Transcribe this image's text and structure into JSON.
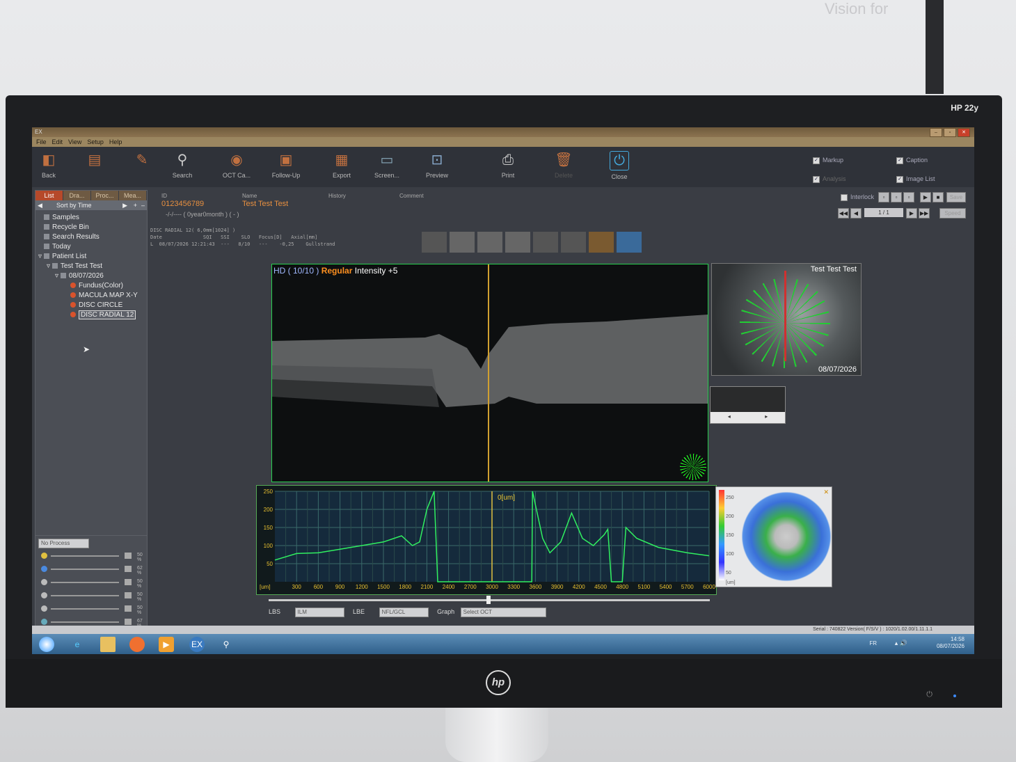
{
  "environment": {
    "wall_text": "Vision for",
    "monitor_model": "HP 22y",
    "logo": "hp"
  },
  "window": {
    "title": "EX",
    "controls": [
      "–",
      "▫",
      "✕"
    ]
  },
  "menu": [
    "File",
    "Edit",
    "View",
    "Setup",
    "Help"
  ],
  "toolbar": {
    "buttons": [
      {
        "label": "Back",
        "icon": "back-icon"
      },
      {
        "label": "",
        "icon": "doc-icon"
      },
      {
        "label": "",
        "icon": "edit-icon"
      },
      {
        "label": "Search",
        "icon": "search-icon"
      },
      {
        "label": "OCT Ca...",
        "icon": "oct-capture-icon"
      },
      {
        "label": "Follow-Up",
        "icon": "follow-up-icon"
      },
      {
        "label": "Export",
        "icon": "export-icon"
      },
      {
        "label": "Screen...",
        "icon": "screen-icon"
      },
      {
        "label": "Preview",
        "icon": "preview-icon"
      },
      {
        "label": "Print",
        "icon": "print-icon"
      },
      {
        "label": "Delete",
        "icon": "delete-icon"
      },
      {
        "label": "Close",
        "icon": "power-icon"
      }
    ],
    "checks": {
      "markup": "Markup",
      "analysis": "Analysis",
      "caption": "Caption",
      "image_list": "Image List"
    }
  },
  "left_panel": {
    "tabs": [
      "List",
      "Dra...",
      "Proc...",
      "Mea..."
    ],
    "sort_label": "Sort by Time",
    "tree": {
      "samples": "Samples",
      "recycle": "Recycle Bin",
      "search_results": "Search Results",
      "today": "Today",
      "patient_list": "Patient List",
      "patient": "Test Test Test",
      "date": "08/07/2026",
      "fundus": "Fundus(Color)",
      "macula": "MACULA MAP X-Y",
      "disc_circle": "DISC CIRCLE",
      "disc_radial": "DISC RADIAL 12"
    }
  },
  "process": {
    "select": "No Process",
    "levels": [
      "50 %",
      "62 %",
      "50 %",
      "50 %",
      "50 %",
      "67 %"
    ]
  },
  "patient": {
    "id_label": "ID",
    "id": "0123456789",
    "name_label": "Name",
    "name": "Test Test Test",
    "history_label": "History",
    "comment_label": "Comment",
    "age": "-/-/---- ( 0year0month )   ( - )"
  },
  "scan": {
    "header": "DISC RADIAL 12( 6,0mm[1024] )",
    "cols": "Date              SQI   SSI    SLO   Focus[D]   Axial[mm]",
    "row": "L  08/07/2026 12:21:43  ---   8/10   ---    -0,25    Gullstrand"
  },
  "interlock": {
    "label": "Interlock",
    "save": "Save",
    "speed": "Speed",
    "page": "1 / 1"
  },
  "oct_image": {
    "hd": "HD ( 10/10 )",
    "mode": "Regular",
    "intensity": "Intensity +5"
  },
  "fundus": {
    "name": "Test Test Test",
    "date": "08/07/2026"
  },
  "chart_data": {
    "type": "line",
    "title": "",
    "cursor_label": "0[um]",
    "xlabel": "[um]",
    "ylabel": "",
    "xlim": [
      0,
      6000
    ],
    "ylim": [
      0,
      250
    ],
    "x_ticks": [
      "300",
      "600",
      "900",
      "1200",
      "1500",
      "1800",
      "2100",
      "2400",
      "2700",
      "3000",
      "3300",
      "3600",
      "3900",
      "4200",
      "4500",
      "4800",
      "5100",
      "5400",
      "5700",
      "6000"
    ],
    "y_ticks": [
      "250",
      "200",
      "150",
      "100",
      "50"
    ],
    "series": [
      {
        "points": [
          [
            0,
            60
          ],
          [
            300,
            78
          ],
          [
            600,
            80
          ],
          [
            900,
            90
          ],
          [
            1200,
            100
          ],
          [
            1500,
            110
          ],
          [
            1750,
            127
          ],
          [
            1900,
            100
          ],
          [
            2000,
            110
          ],
          [
            2100,
            200
          ],
          [
            2200,
            250
          ],
          [
            2250,
            0
          ],
          [
            3550,
            0
          ],
          [
            3560,
            250
          ],
          [
            3700,
            120
          ],
          [
            3800,
            80
          ],
          [
            3950,
            110
          ],
          [
            4100,
            190
          ],
          [
            4250,
            120
          ],
          [
            4400,
            100
          ],
          [
            4550,
            130
          ],
          [
            4600,
            145
          ],
          [
            4650,
            0
          ],
          [
            4800,
            0
          ],
          [
            4850,
            150
          ],
          [
            5000,
            120
          ],
          [
            5300,
            95
          ],
          [
            5700,
            80
          ],
          [
            6000,
            72
          ]
        ]
      }
    ],
    "cursor_x": 3000,
    "grid": true
  },
  "polar_map": {
    "scale": [
      "250",
      "200",
      "150",
      "100",
      "50",
      "[um]"
    ]
  },
  "bottom": {
    "lbs_label": "LBS",
    "lbs": "ILM",
    "lbe_label": "LBE",
    "lbe": "NFL/GCL",
    "graph_label": "Graph",
    "graph": "Select OCT"
  },
  "statusbar": "Serial : 740822  Version( F/S/V ) : 1020/1.02.00/1.11.1.1",
  "taskbar": {
    "lang": "FR",
    "time": "14:58",
    "date": "08/07/2026"
  }
}
